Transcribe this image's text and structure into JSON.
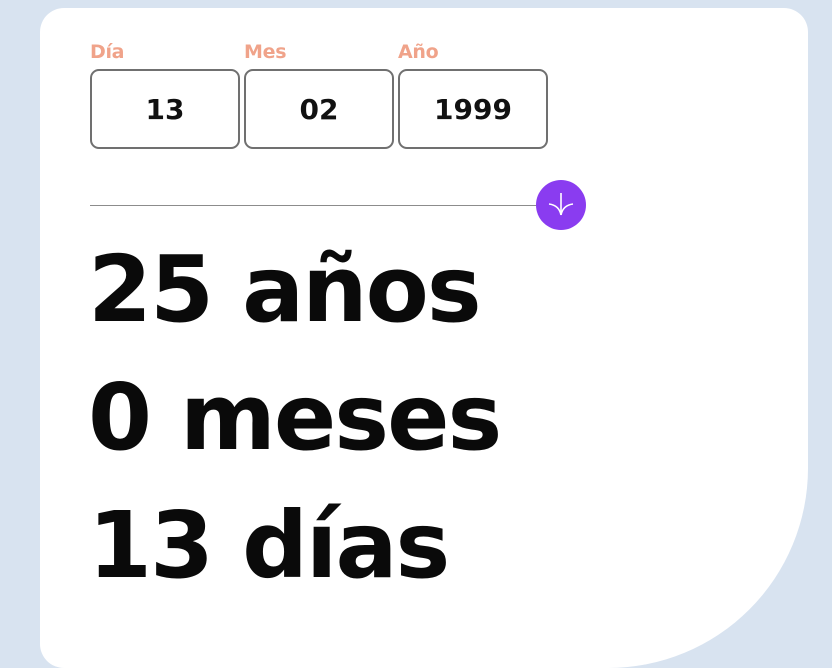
{
  "form": {
    "day": {
      "label": "Día",
      "value": "13"
    },
    "month": {
      "label": "Mes",
      "value": "02"
    },
    "year": {
      "label": "Año",
      "value": "1999"
    }
  },
  "submit": {
    "icon": "arrow-down-icon",
    "color": "#8a3cf0"
  },
  "result": {
    "years_value": "25",
    "years_unit": "años",
    "months_value": "0",
    "months_unit": "meses",
    "days_value": "13",
    "days_unit": "días"
  },
  "colors": {
    "label": "#f0a38a",
    "accent": "#8a3cf0",
    "background": "#d8e3f0",
    "card": "#ffffff"
  }
}
